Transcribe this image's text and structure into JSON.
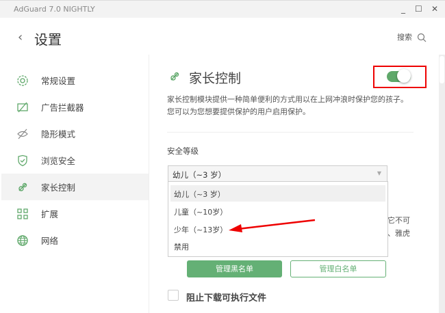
{
  "window": {
    "title": "AdGuard 7.0 NIGHTLY",
    "minimize": "_",
    "maximize": "☐",
    "close": "✕"
  },
  "header": {
    "back": "‹",
    "title": "设置",
    "search_label": "搜索"
  },
  "sidebar": {
    "items": [
      {
        "label": "常规设置",
        "icon": "gear-icon"
      },
      {
        "label": "广告拦截器",
        "icon": "ad-block-icon"
      },
      {
        "label": "隐形模式",
        "icon": "eye-off-icon"
      },
      {
        "label": "浏览安全",
        "icon": "shield-icon"
      },
      {
        "label": "家长控制",
        "icon": "pacifier-icon",
        "active": true
      },
      {
        "label": "扩展",
        "icon": "grid-icon"
      },
      {
        "label": "网络",
        "icon": "globe-icon"
      }
    ]
  },
  "main": {
    "title": "家长控制",
    "toggle_on": true,
    "description": "家长控制模块提供一种简单便利的方式用以在上网冲浪时保护您的孩子。您可以为您想要提供保护的用户启用保护。",
    "level_label": "安全等级",
    "level_selected": "幼儿（~3 岁）",
    "level_options": [
      "幼儿（~3 岁）",
      "儿童（~10岁）",
      "少年（~13岁）",
      "禁用"
    ],
    "behind_text": [
      "它不可",
      "、雅虎"
    ],
    "blacklist_button": "管理黑名单",
    "whitelist_button": "管理白名单",
    "block_exe_label": "阻止下载可执行文件"
  },
  "colors": {
    "accent": "#64b075",
    "highlight": "#e00000"
  }
}
